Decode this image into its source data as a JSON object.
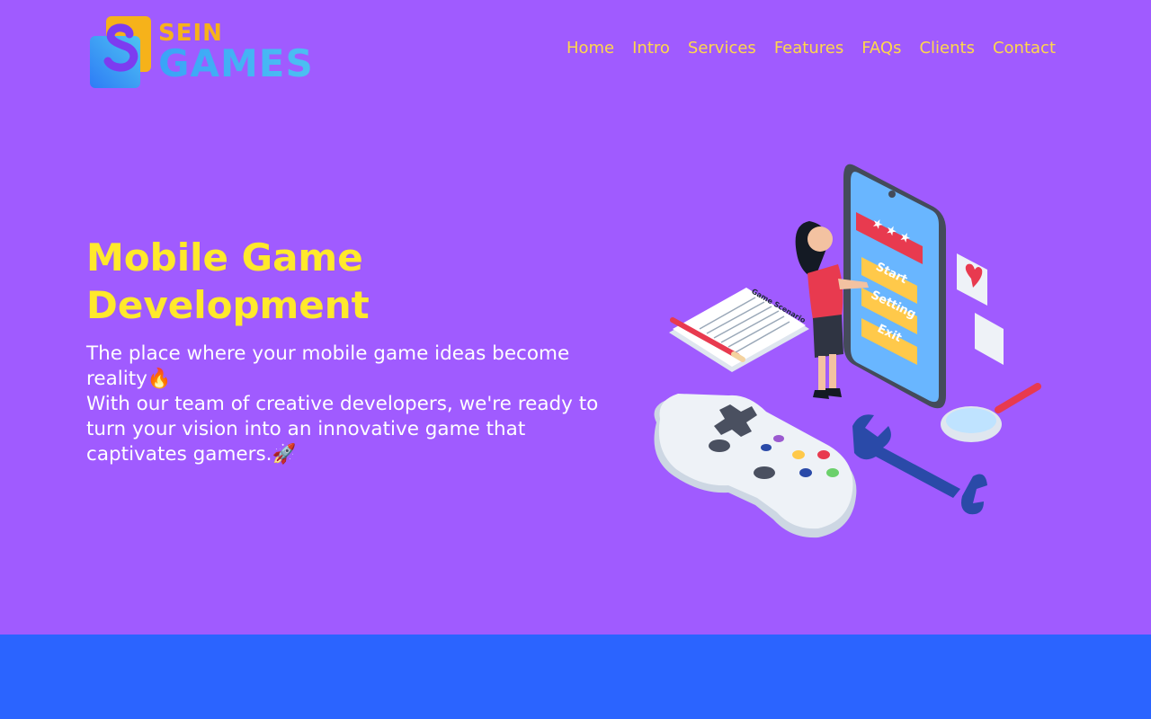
{
  "brand": {
    "line1": "SEIN",
    "line2": "GAMES",
    "colors": {
      "accent": "#f6b21a",
      "blue": "#3aa3f7"
    }
  },
  "nav": {
    "items": [
      {
        "label": "Home"
      },
      {
        "label": "Intro"
      },
      {
        "label": "Services"
      },
      {
        "label": "Features"
      },
      {
        "label": "FAQs"
      },
      {
        "label": "Clients"
      },
      {
        "label": "Contact"
      }
    ]
  },
  "hero": {
    "title": "Mobile Game Development",
    "paragraph1": "The place where your mobile game ideas become reality🔥",
    "paragraph2": "With our team of creative developers, we're ready to turn your vision into an innovative game that captivates gamers.🚀",
    "illustration": {
      "scenario_label": "Game Scenario",
      "menu_buttons": [
        "Start",
        "Setting",
        "Exit"
      ],
      "stars": "★ ★ ★"
    }
  },
  "colors": {
    "hero_bg": "#a05bff",
    "band_bg": "#2b64ff",
    "title": "#ffe92b",
    "nav_link": "#ffd84a"
  }
}
